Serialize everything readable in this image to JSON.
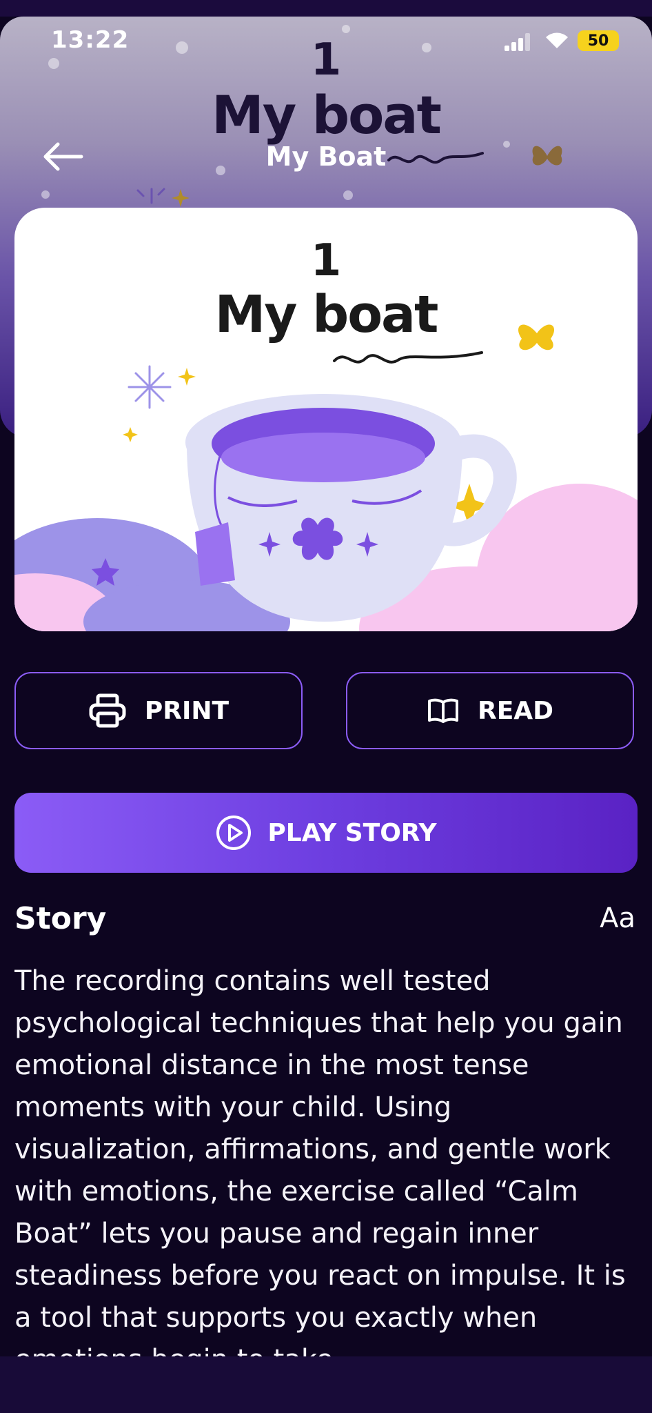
{
  "status_bar": {
    "time": "13:22",
    "battery": "50"
  },
  "header": {
    "back_icon": "arrow-left-icon",
    "subtitle": "My Boat"
  },
  "cover": {
    "number": "1",
    "title": "My boat"
  },
  "actions": {
    "print_label": "PRINT",
    "read_label": "READ",
    "play_label": "PLAY STORY"
  },
  "story": {
    "heading": "Story",
    "font_size_label": "Aa",
    "text": "The recording contains well tested psychological techniques that help you gain emotional distance in the most tense moments with your child. Using visualization, affirmations, and gentle work with emotions, the exercise called “Calm Boat” lets you pause and regain inner steadiness before you react on impulse. It is a tool that supports you exactly when emotions begin to take"
  },
  "colors": {
    "background": "#0d0520",
    "accent": "#8b5cf6",
    "play_gradient_start": "#8b5cf6",
    "play_gradient_end": "#5a22c4",
    "battery": "#f6d21d"
  }
}
